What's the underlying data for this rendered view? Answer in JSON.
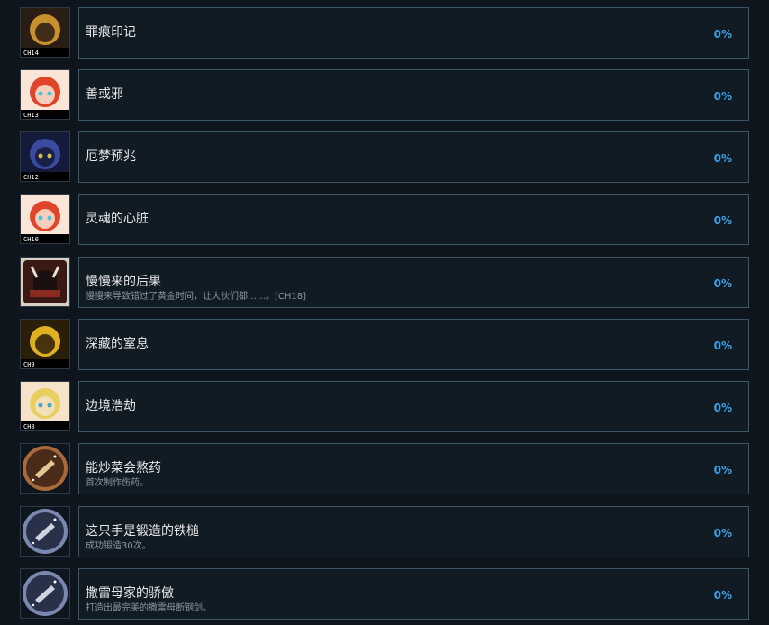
{
  "achievements": [
    {
      "title": "罪痕印记",
      "description": "",
      "percent": "0%",
      "badge": "CH14",
      "icon": "sin-mark-emblem-icon",
      "colors": [
        "#2a1d14",
        "#c8902e",
        "#3a2a1c"
      ]
    },
    {
      "title": "善或邪",
      "description": "",
      "percent": "0%",
      "badge": "CH13",
      "icon": "red-hair-girl-portrait-icon",
      "colors": [
        "#fbe5d6",
        "#e0442a",
        "#40c8d8"
      ]
    },
    {
      "title": "厄梦预兆",
      "description": "",
      "percent": "0%",
      "badge": "CH12",
      "icon": "dark-knight-portrait-icon",
      "colors": [
        "#141a3a",
        "#3a4aa0",
        "#d8c040"
      ]
    },
    {
      "title": "灵魂的心脏",
      "description": "",
      "percent": "0%",
      "badge": "CH10",
      "icon": "crying-girl-portrait-icon",
      "colors": [
        "#fbe5d6",
        "#e0442a",
        "#40c8d8"
      ]
    },
    {
      "title": "慢慢来的后果",
      "description": "慢慢来导致错过了黄金时间，让大伙们都……。[CH18]",
      "percent": "0%",
      "badge": "",
      "icon": "horned-helmet-icon",
      "colors": [
        "#3a1814",
        "#8a2a20",
        "#1a1010"
      ]
    },
    {
      "title": "深藏的窒息",
      "description": "",
      "percent": "0%",
      "badge": "CH9",
      "icon": "golden-beast-portrait-icon",
      "colors": [
        "#2a1e08",
        "#e0b020",
        "#4a2c10"
      ]
    },
    {
      "title": "边境浩劫",
      "description": "",
      "percent": "0%",
      "badge": "CH8",
      "icon": "blonde-girl-portrait-icon",
      "colors": [
        "#f5e2c8",
        "#e8d060",
        "#40a8c8"
      ]
    },
    {
      "title": "能炒菜会熬药",
      "description": "首次制作伤药。",
      "percent": "0%",
      "badge": "",
      "icon": "frying-pan-potion-icon",
      "colors": [
        "#4a2a18",
        "#a86a3a",
        "#f0d8a0"
      ]
    },
    {
      "title": "这只手是锻造的铁槌",
      "description": "成功锻造30次。",
      "percent": "0%",
      "badge": "",
      "icon": "forge-hammer-30-icon",
      "colors": [
        "#28304a",
        "#7a88b0",
        "#e0e6f0"
      ]
    },
    {
      "title": "撒雷母家的骄傲",
      "description": "打造出最完美的撒雷母断钢剑。",
      "percent": "0%",
      "badge": "",
      "icon": "sword-forge-icon",
      "colors": [
        "#28304a",
        "#7a88b0",
        "#e0e6f0"
      ]
    }
  ]
}
